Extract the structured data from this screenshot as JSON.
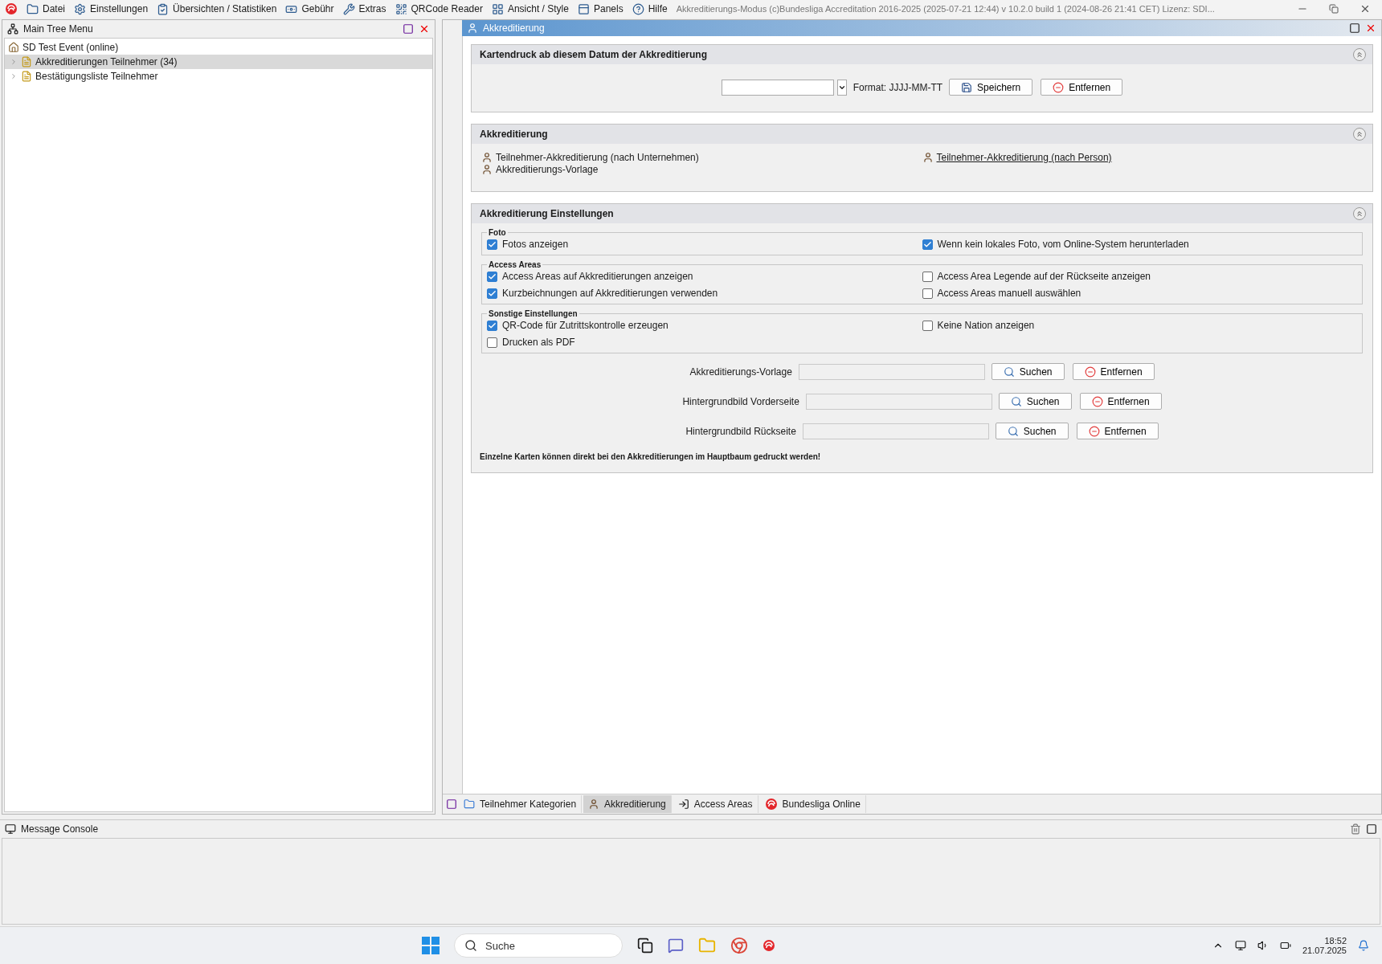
{
  "menu_bar": {
    "items": [
      {
        "label": "Datei"
      },
      {
        "label": "Einstellungen"
      },
      {
        "label": "Übersichten / Statistiken"
      },
      {
        "label": "Gebühr"
      },
      {
        "label": "Extras"
      },
      {
        "label": "QRCode Reader"
      },
      {
        "label": "Ansicht / Style"
      },
      {
        "label": "Panels"
      },
      {
        "label": "Hilfe"
      }
    ],
    "title": "Akkreditierungs-Modus (c)Bundesliga Accreditation 2016-2025 (2025-07-21 12:44) v 10.2.0 build 1 (2024-08-26 21:41 CET) Lizenz: SDI..."
  },
  "left_panel": {
    "title": "Main Tree Menu",
    "tree": [
      {
        "label": "SD Test Event (online)",
        "selected": false,
        "children": [
          {
            "label": "Akkreditierungen Teilnehmer (34)",
            "selected": true,
            "expanded": false
          },
          {
            "label": "Bestätigungsliste Teilnehmer",
            "selected": false,
            "expanded": false
          }
        ]
      }
    ]
  },
  "right_panel": {
    "title": "Akkreditierung",
    "sections": [
      {
        "kind": "date",
        "title": "Kartendruck ab diesem Datum der Akkreditierung",
        "expanded": true,
        "format_label": "Format: JJJJ-MM-TT",
        "buttons": [
          {
            "kind": "save",
            "label": "Speichern"
          },
          {
            "kind": "remove",
            "label": "Entfernen"
          }
        ]
      },
      {
        "kind": "links",
        "title": "Akkreditierung",
        "expanded": true,
        "columns": [
          [
            {
              "label": "Teilnehmer-Akkreditierung (nach Unternehmen)",
              "hovered": false
            },
            {
              "label": "Akkreditierungs-Vorlage",
              "hovered": false
            }
          ],
          [
            {
              "label": "Teilnehmer-Akkreditierung (nach Person)",
              "hovered": true
            }
          ]
        ]
      },
      {
        "kind": "settings",
        "title": "Akkreditierung Einstellungen",
        "expanded": true,
        "groups": [
          {
            "title": "Foto",
            "columns": [
              [
                {
                  "label": "Fotos anzeigen",
                  "checked": true
                }
              ],
              [
                {
                  "label": "Wenn kein lokales Foto, vom Online-System herunterladen",
                  "checked": true
                }
              ]
            ]
          },
          {
            "title": "Access Areas",
            "columns": [
              [
                {
                  "label": "Access Areas auf Akkreditierungen anzeigen",
                  "checked": true
                },
                {
                  "label": "Kurzbeichnungen auf Akkreditierungen verwenden",
                  "checked": true
                }
              ],
              [
                {
                  "label": "Access Area Legende auf der Rückseite anzeigen",
                  "checked": false
                },
                {
                  "label": "Access Areas manuell auswählen",
                  "checked": false
                }
              ]
            ]
          },
          {
            "title": "Sonstige Einstellungen",
            "columns": [
              [
                {
                  "label": "QR-Code für Zutrittskontrolle erzeugen",
                  "checked": true
                },
                {
                  "label": "Drucken als PDF",
                  "checked": false
                }
              ],
              [
                {
                  "label": "Keine Nation anzeigen",
                  "checked": false
                }
              ]
            ]
          }
        ],
        "file_rows": [
          {
            "label": "Akkreditierungs-Vorlage",
            "buttons": [
              {
                "kind": "search",
                "label": "Suchen"
              },
              {
                "kind": "remove",
                "label": "Entfernen"
              }
            ]
          },
          {
            "label": "Hintergrundbild Vorderseite",
            "buttons": [
              {
                "kind": "search",
                "label": "Suchen"
              },
              {
                "kind": "remove",
                "label": "Entfernen"
              }
            ]
          },
          {
            "label": "Hintergrundbild Rückseite",
            "buttons": [
              {
                "kind": "search",
                "label": "Suchen"
              },
              {
                "kind": "remove",
                "label": "Entfernen"
              }
            ]
          }
        ],
        "note": "Einzelne Karten können direkt bei den Akkreditierungen im Hauptbaum gedruckt werden!"
      }
    ]
  },
  "bottom_tabs": [
    {
      "label": "Teilnehmer Kategorien",
      "selected": false
    },
    {
      "label": "Akkreditierung",
      "selected": true
    },
    {
      "label": "Access Areas",
      "selected": false
    },
    {
      "label": "Bundesliga Online",
      "selected": false
    }
  ],
  "console": {
    "title": "Message Console"
  },
  "taskbar": {
    "search_placeholder": "Suche",
    "time": "18:52",
    "date": "21.07.2025"
  }
}
